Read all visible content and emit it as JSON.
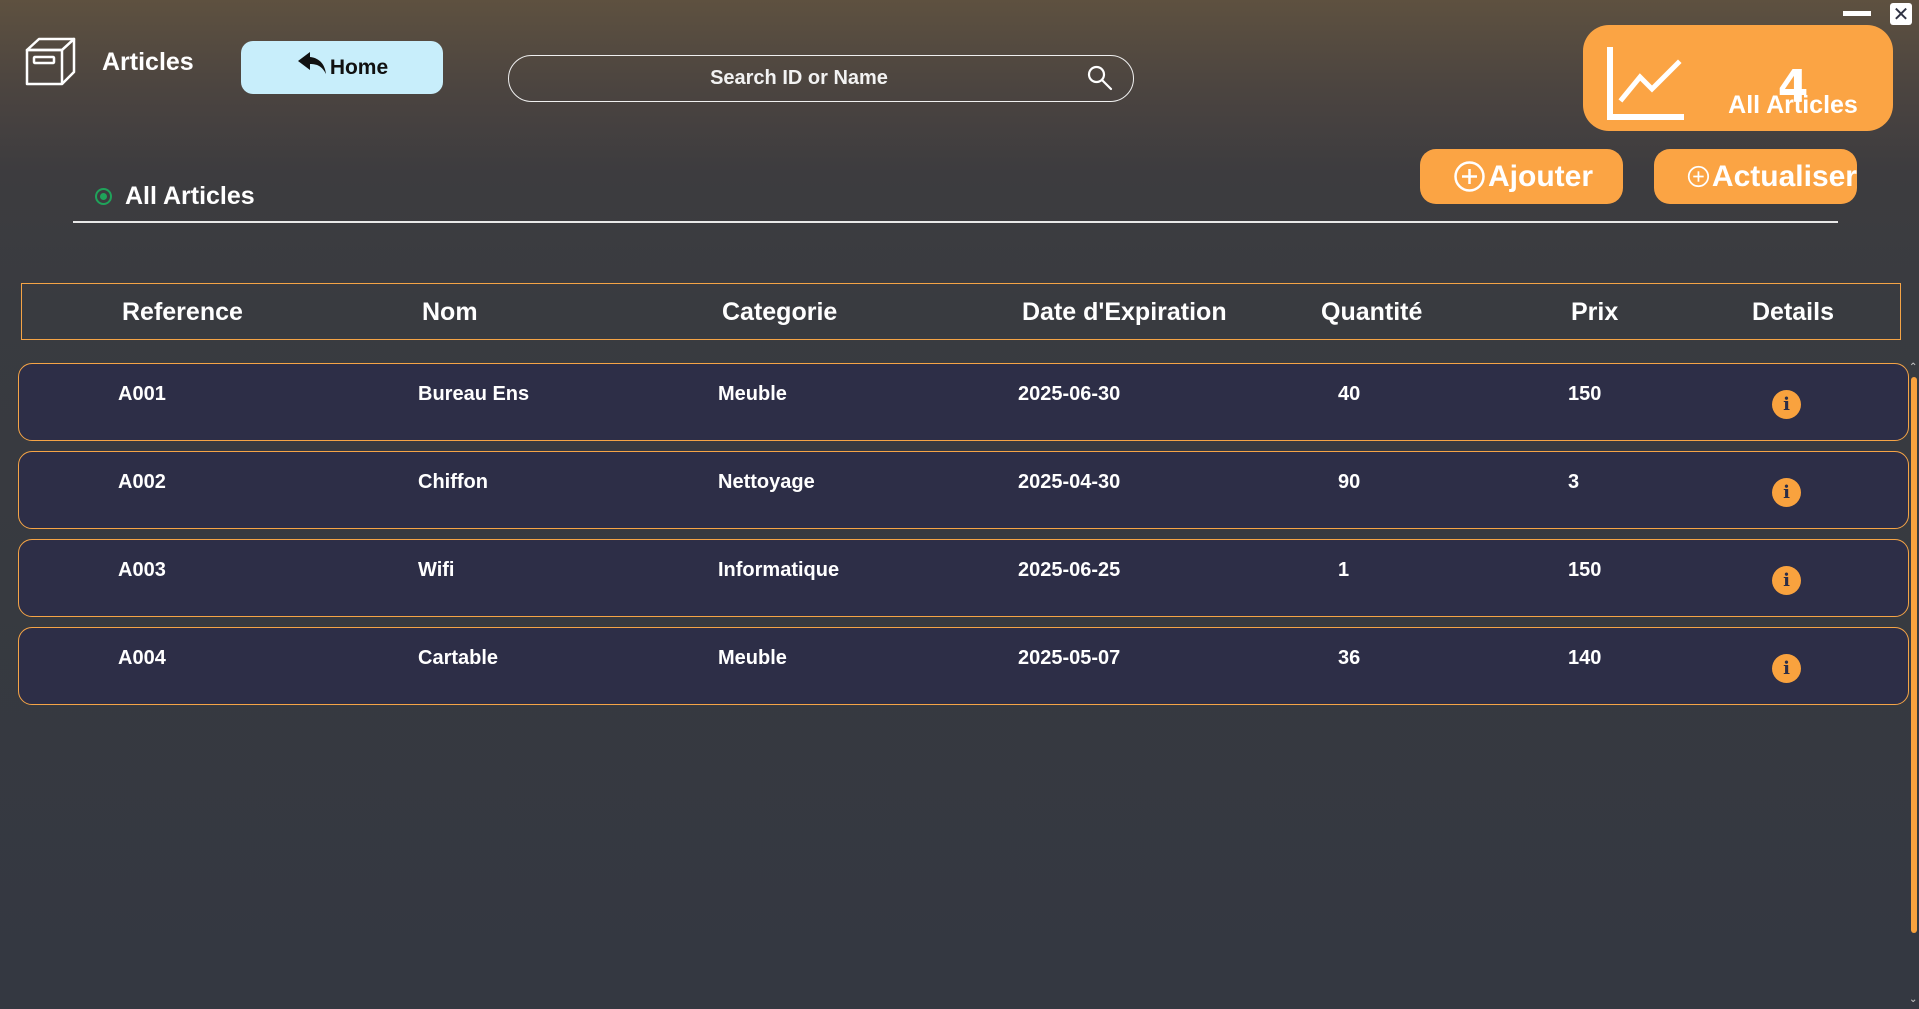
{
  "window": {
    "close_glyph": "✕"
  },
  "header": {
    "logo_icon": "box-icon",
    "title": "Articles",
    "home_label": "Home",
    "home_icon": "undo-arrow-icon",
    "search_placeholder": "Search ID or Name",
    "search_value": ""
  },
  "stat_card": {
    "count": "4",
    "label": "All Articles",
    "icon": "line-chart-icon"
  },
  "actions": {
    "add_label": "Ajouter",
    "refresh_label": "Actualiser"
  },
  "section": {
    "title": "All Articles"
  },
  "table": {
    "columns": [
      "Reference",
      "Nom",
      "Categorie",
      "Date d'Expiration",
      "Quantité",
      "Prix",
      "Details"
    ],
    "rows": [
      [
        "A001",
        "Bureau Ens",
        "Meuble",
        "2025-06-30",
        "40",
        "150"
      ],
      [
        "A002",
        "Chiffon",
        "Nettoyage",
        "2025-04-30",
        "90",
        "3"
      ],
      [
        "A003",
        "Wifi",
        "Informatique",
        "2025-06-25",
        "1",
        "150"
      ],
      [
        "A004",
        "Cartable",
        "Meuble",
        "2025-05-07",
        "36",
        "140"
      ]
    ],
    "details_icon": "info-icon",
    "details_glyph": "i"
  },
  "colors": {
    "accent": "#fba444",
    "row_bg": "#2d2e47",
    "home_bg": "#c8eefb",
    "status_green": "#1fa35a"
  }
}
